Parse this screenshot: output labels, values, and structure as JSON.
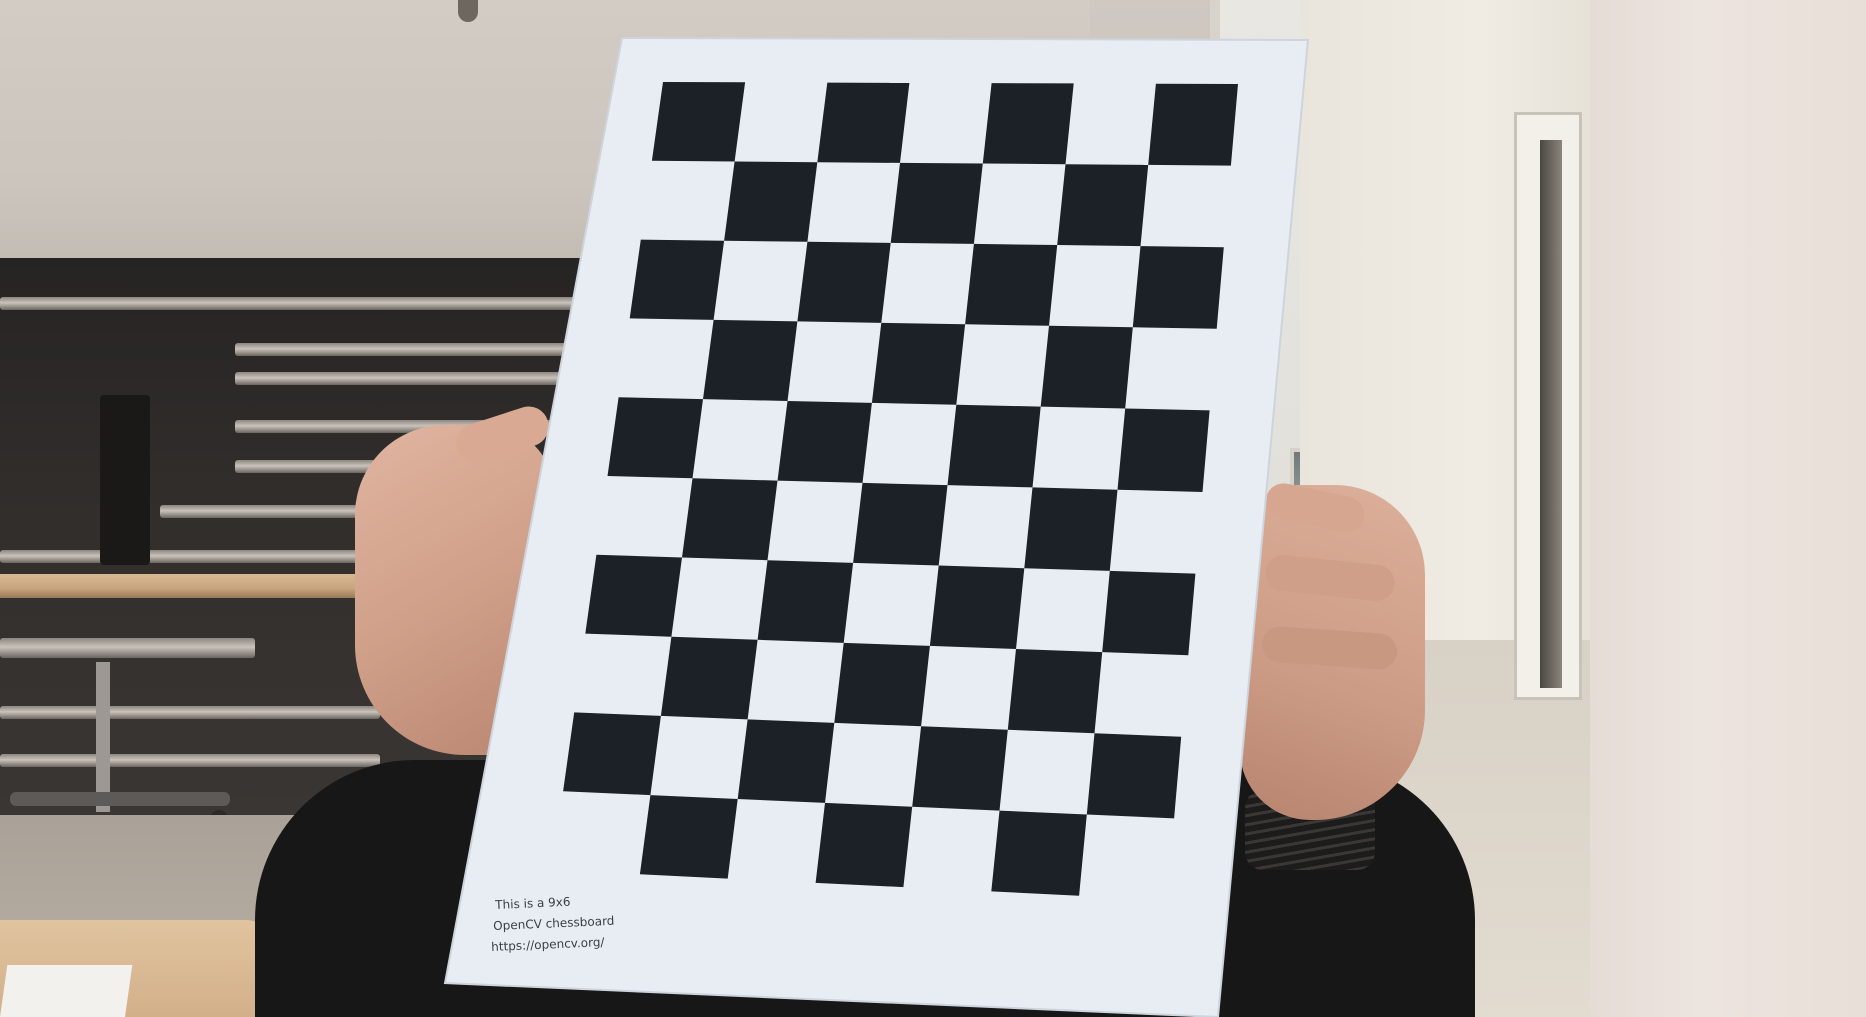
{
  "scene": {
    "subject": "person holding a printed calibration chessboard in front of their face",
    "colors": {
      "board_paper": "#e7edf3",
      "square_dark": "#1c2027",
      "sweater": "#171717",
      "skin": "#d4a48e"
    },
    "board": {
      "caption_lines": [
        "This is a 9x6",
        "OpenCV chessboard",
        "https://opencv.org/"
      ],
      "rows": 10,
      "cols": 7
    },
    "icons": {
      "ceiling_light": "ceiling-light-icon"
    }
  }
}
